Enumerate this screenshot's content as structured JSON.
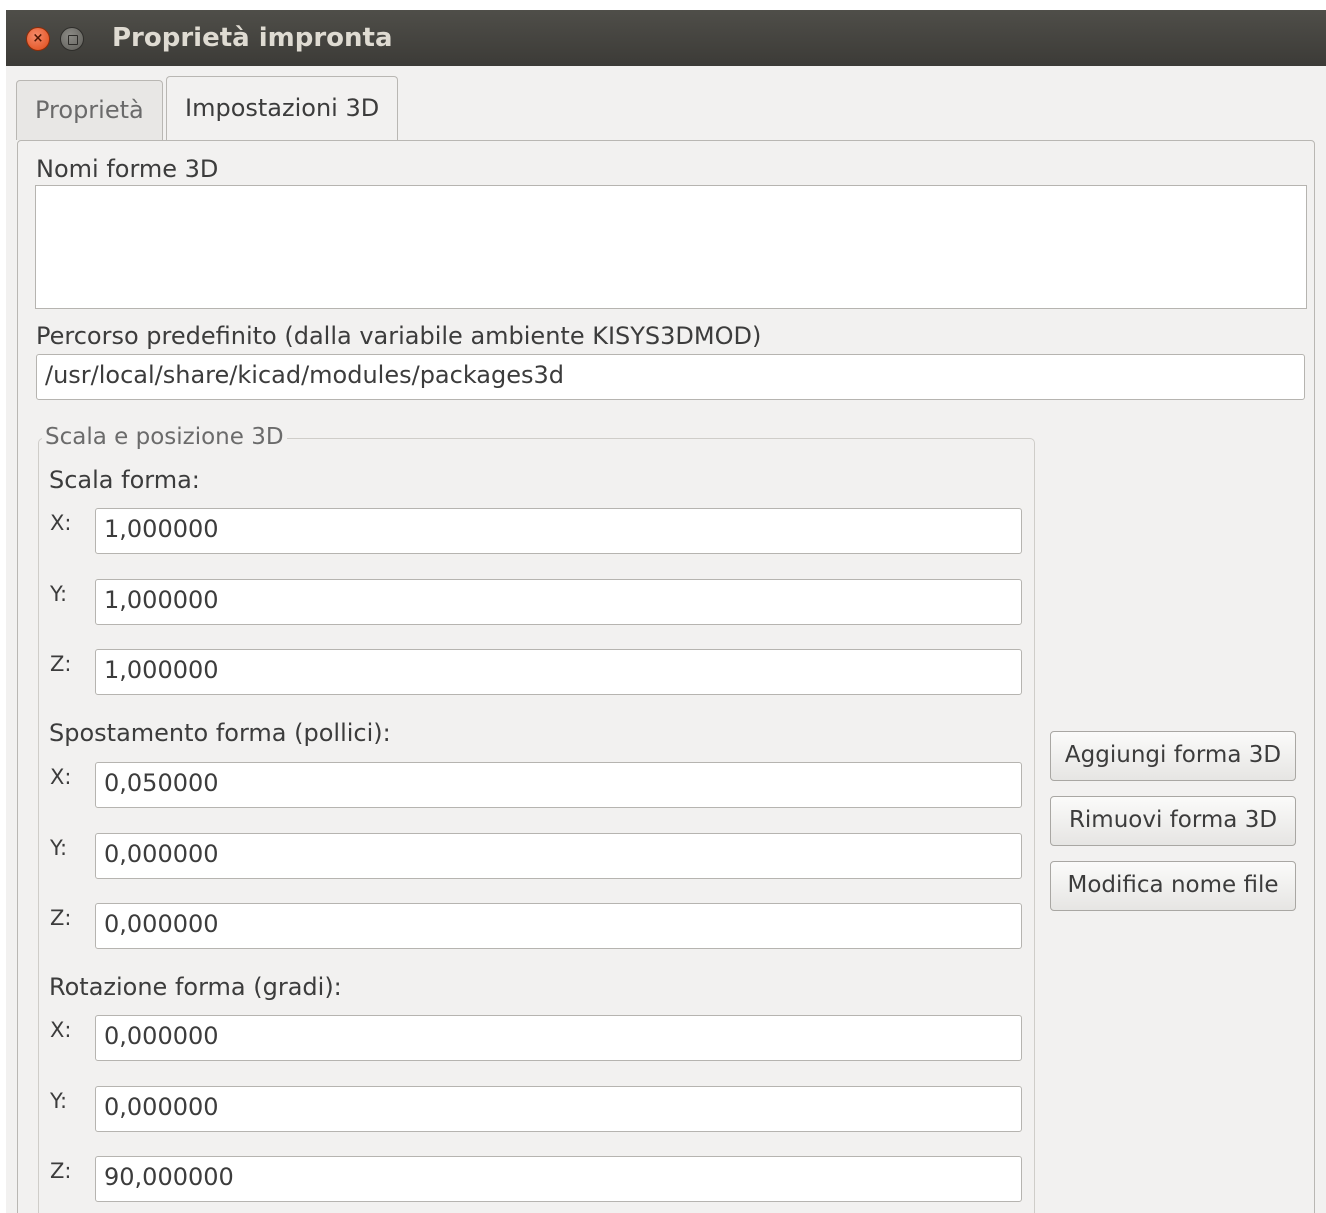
{
  "window": {
    "title": "Proprietà impronta",
    "close_glyph": "×"
  },
  "tabs": [
    {
      "label": "Proprietà",
      "active": false
    },
    {
      "label": "Impostazioni 3D",
      "active": true
    }
  ],
  "shapes": {
    "label": "Nomi forme 3D",
    "items": []
  },
  "default_path": {
    "label": "Percorso predefinito (dalla variabile ambiente KISYS3DMOD)",
    "value": "/usr/local/share/kicad/modules/packages3d"
  },
  "group": {
    "title": "Scala e posizione 3D",
    "scale": {
      "label": "Scala forma:",
      "x": {
        "axis": "X:",
        "value": "1,000000"
      },
      "y": {
        "axis": "Y:",
        "value": "1,000000"
      },
      "z": {
        "axis": "Z:",
        "value": "1,000000"
      }
    },
    "offset": {
      "label": "Spostamento forma (pollici):",
      "x": {
        "axis": "X:",
        "value": "0,050000"
      },
      "y": {
        "axis": "Y:",
        "value": "0,000000"
      },
      "z": {
        "axis": "Z:",
        "value": "0,000000"
      }
    },
    "rotation": {
      "label": "Rotazione forma (gradi):",
      "x": {
        "axis": "X:",
        "value": "0,000000"
      },
      "y": {
        "axis": "Y:",
        "value": "0,000000"
      },
      "z": {
        "axis": "Z:",
        "value": "90,000000"
      }
    }
  },
  "buttons": {
    "add": "Aggiungi forma 3D",
    "remove": "Rimuovi forma 3D",
    "edit": "Modifica nome file"
  }
}
